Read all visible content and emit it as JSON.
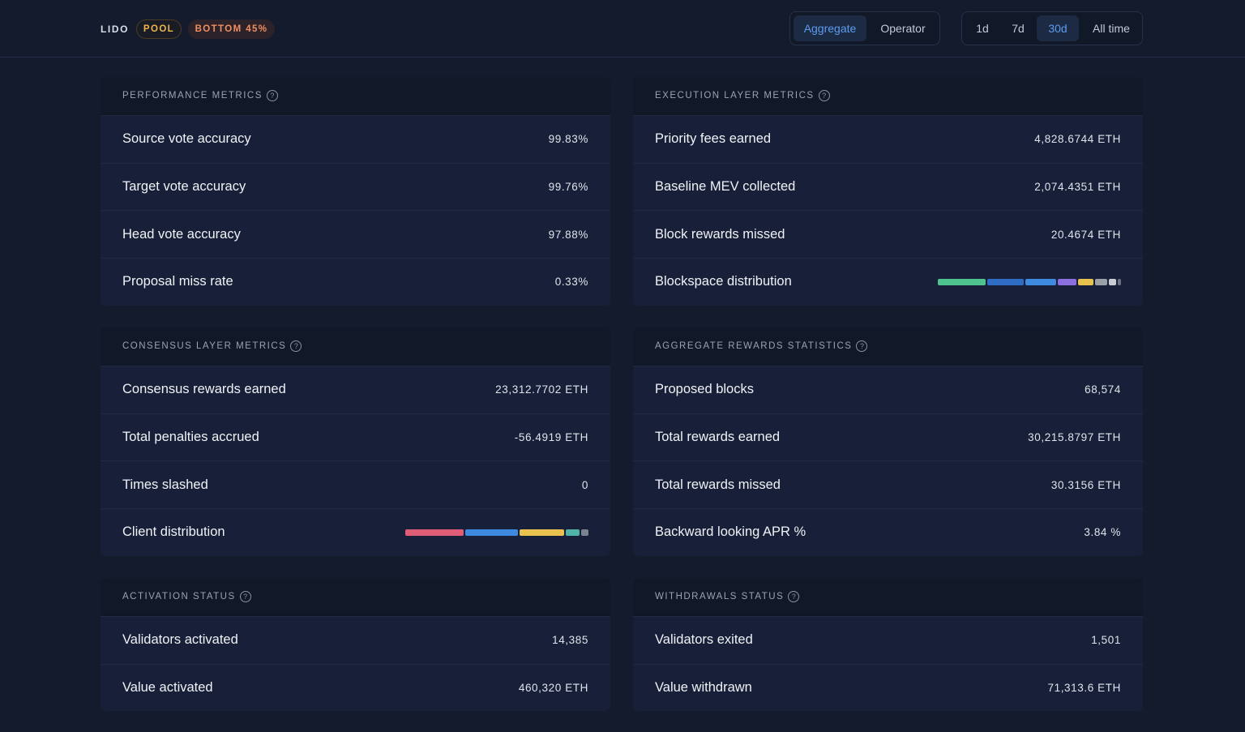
{
  "header": {
    "brand": "LIDO",
    "badge_pool": "POOL",
    "badge_rank": "BOTTOM 45%",
    "view_tabs": [
      "Aggregate",
      "Operator"
    ],
    "view_selected": "Aggregate",
    "range_tabs": [
      "1d",
      "7d",
      "30d",
      "All time"
    ],
    "range_selected": "30d"
  },
  "panels": {
    "performance": {
      "title": "PERFORMANCE METRICS",
      "rows": [
        {
          "label": "Source vote accuracy",
          "value": "99.83%"
        },
        {
          "label": "Target vote accuracy",
          "value": "99.76%"
        },
        {
          "label": "Head vote accuracy",
          "value": "97.88%"
        },
        {
          "label": "Proposal miss rate",
          "value": "0.33%"
        }
      ]
    },
    "execution": {
      "title": "EXECUTION LAYER METRICS",
      "rows": [
        {
          "label": "Priority fees earned",
          "value": "4,828.6744 ETH"
        },
        {
          "label": "Baseline MEV collected",
          "value": "2,074.4351 ETH"
        },
        {
          "label": "Block rewards missed",
          "value": "20.4674 ETH"
        },
        {
          "label": "Blockspace distribution",
          "value": ""
        }
      ],
      "distribution": [
        {
          "share": 0.28,
          "color": "#4fc38e"
        },
        {
          "share": 0.21,
          "color": "#2f6cc4"
        },
        {
          "share": 0.18,
          "color": "#3d8ae0"
        },
        {
          "share": 0.11,
          "color": "#8b6fe0"
        },
        {
          "share": 0.09,
          "color": "#e8c14e"
        },
        {
          "share": 0.07,
          "color": "#9aa0a8"
        },
        {
          "share": 0.04,
          "color": "#c9ccd2"
        },
        {
          "share": 0.02,
          "color": "#6b7380"
        }
      ]
    },
    "consensus": {
      "title": "CONSENSUS LAYER METRICS",
      "rows": [
        {
          "label": "Consensus rewards earned",
          "value": "23,312.7702 ETH"
        },
        {
          "label": "Total penalties accrued",
          "value": "-56.4919 ETH"
        },
        {
          "label": "Times slashed",
          "value": "0"
        },
        {
          "label": "Client distribution",
          "value": ""
        }
      ],
      "distribution": [
        {
          "share": 0.33,
          "color": "#e05d78"
        },
        {
          "share": 0.3,
          "color": "#3d8ae0"
        },
        {
          "share": 0.25,
          "color": "#e8c14e"
        },
        {
          "share": 0.08,
          "color": "#4fb3a8"
        },
        {
          "share": 0.04,
          "color": "#7b8290"
        }
      ]
    },
    "aggregate": {
      "title": "AGGREGATE REWARDS STATISTICS",
      "rows": [
        {
          "label": "Proposed blocks",
          "value": "68,574"
        },
        {
          "label": "Total rewards earned",
          "value": "30,215.8797 ETH"
        },
        {
          "label": "Total rewards missed",
          "value": "30.3156 ETH"
        },
        {
          "label": "Backward looking APR %",
          "value": "3.84 %"
        }
      ]
    },
    "activation": {
      "title": "ACTIVATION STATUS",
      "rows": [
        {
          "label": "Validators activated",
          "value": "14,385"
        },
        {
          "label": "Value activated",
          "value": "460,320 ETH"
        }
      ]
    },
    "withdrawals": {
      "title": "WITHDRAWALS STATUS",
      "rows": [
        {
          "label": "Validators exited",
          "value": "1,501"
        },
        {
          "label": "Value withdrawn",
          "value": "71,313.6 ETH"
        }
      ]
    }
  }
}
